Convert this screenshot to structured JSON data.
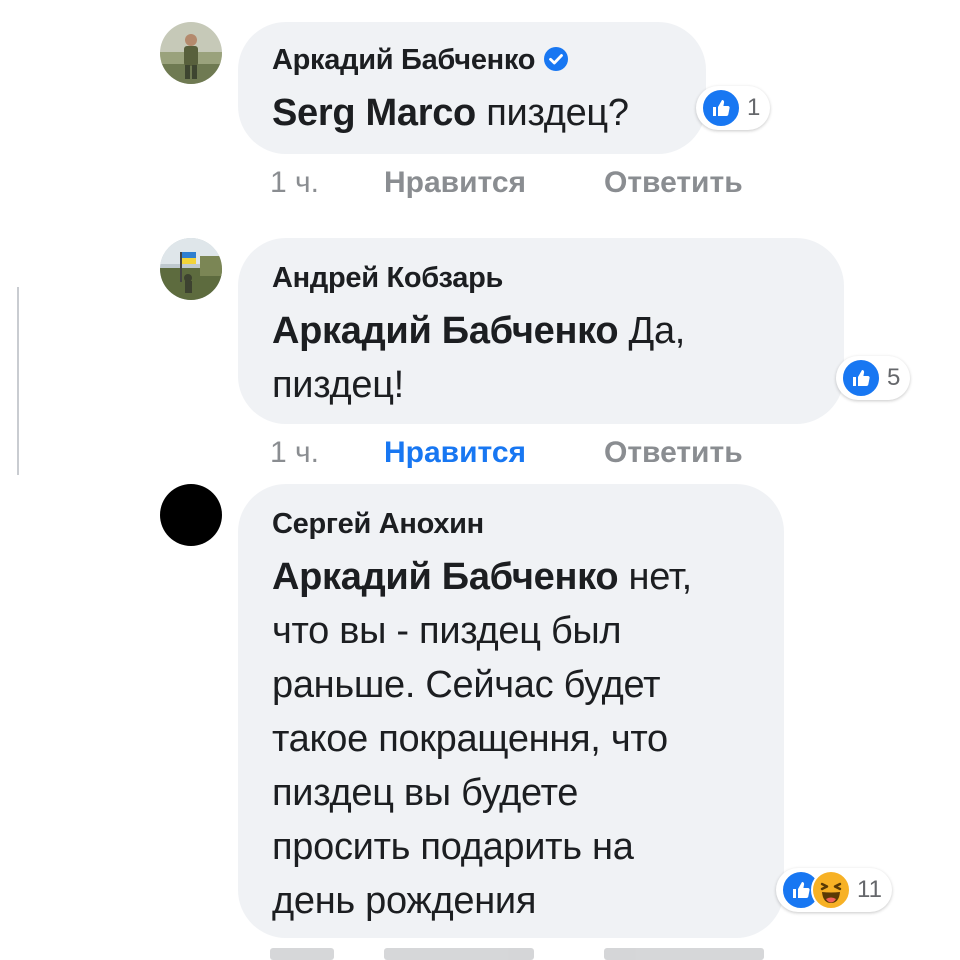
{
  "colors": {
    "bubble": "#f0f2f5",
    "link_blue": "#1877f2",
    "meta_gray": "#8a8d91",
    "text": "#1c1e21"
  },
  "comments": [
    {
      "author": "Аркадий Бабченко",
      "verified": true,
      "avatar_icon": "soldier-photo-avatar",
      "mention": "Serg Marco",
      "text_lines": [
        "пиздец?"
      ],
      "reaction_icons": [
        "like-icon"
      ],
      "reaction_count": "1",
      "time": "1 ч.",
      "like_label": "Нравится",
      "like_active": false,
      "reply_label": "Ответить"
    },
    {
      "author": "Андрей Кобзарь",
      "verified": false,
      "avatar_icon": "flag-photo-avatar",
      "mention": "Аркадий Бабченко",
      "text_lines": [
        "Да,",
        "пиздец!"
      ],
      "reaction_icons": [
        "like-icon"
      ],
      "reaction_count": "5",
      "time": "1 ч.",
      "like_label": "Нравится",
      "like_active": true,
      "reply_label": "Ответить"
    },
    {
      "author": "Сергей Анохин",
      "verified": false,
      "avatar_icon": "black-circle-avatar",
      "mention": "Аркадий Бабченко",
      "text_lines": [
        "нет,",
        "что вы - пиздец был",
        "раньше. Сейчас будет",
        "такое покращення, что",
        "пиздец вы будете",
        "просить подарить на",
        "день рождения"
      ],
      "reaction_icons": [
        "like-icon",
        "haha-icon"
      ],
      "reaction_count": "11"
    }
  ]
}
